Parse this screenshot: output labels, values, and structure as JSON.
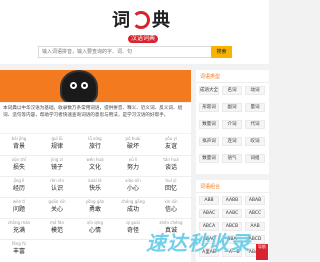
{
  "logo": {
    "left_char": "词",
    "right_char": "典",
    "badge": "汉语词典"
  },
  "search": {
    "placeholder": "输入词语拼音，输入要查询的字、词、句",
    "button_label": "搜索"
  },
  "intro": {
    "text": "本词典以中华汉语为基础，收录数万条常用词语，提供拼音、释义、近义词、反义词、组词、造句等内容，帮助学习者快速查询词语的意思与用法，是学习汉语的好帮手。"
  },
  "words": [
    {
      "py": "bèi jǐng",
      "hz": "背景"
    },
    {
      "py": "guī lǜ",
      "hz": "规律"
    },
    {
      "py": "lǚ xíng",
      "hz": "旅行"
    },
    {
      "py": "pò huài",
      "hz": "破坏"
    },
    {
      "py": "yǒu yì",
      "hz": "友谊"
    },
    {
      "py": "sǔn shī",
      "hz": "损失"
    },
    {
      "py": "jìng zi",
      "hz": "镜子"
    },
    {
      "py": "wén huà",
      "hz": "文化"
    },
    {
      "py": "nǔ lì",
      "hz": "努力"
    },
    {
      "py": "tán huà",
      "hz": "谈话"
    },
    {
      "py": "jīng lì",
      "hz": "经历"
    },
    {
      "py": "rèn shi",
      "hz": "认识"
    },
    {
      "py": "kuài lè",
      "hz": "快乐"
    },
    {
      "py": "xiǎo xīn",
      "hz": "小心"
    },
    {
      "py": "huí yì",
      "hz": "回忆"
    },
    {
      "py": "wèn tí",
      "hz": "问题"
    },
    {
      "py": "guān xīn",
      "hz": "关心"
    },
    {
      "py": "yǒng gǎn",
      "hz": "勇敢"
    },
    {
      "py": "chéng gōng",
      "hz": "成功"
    },
    {
      "py": "xìn xīn",
      "hz": "信心"
    },
    {
      "py": "chōng mǎn",
      "hz": "充满"
    },
    {
      "py": "mó fàn",
      "hz": "模范"
    },
    {
      "py": "xīn qíng",
      "hz": "心情"
    },
    {
      "py": "qí guài",
      "hz": "奇怪"
    },
    {
      "py": "zhēn chéng",
      "hz": "真诚"
    },
    {
      "py": "fēng fù",
      "hz": "丰富"
    }
  ],
  "side1": {
    "title": "词语类型",
    "tags": [
      "成语大全",
      "名词",
      "动词",
      "形容词",
      "副词",
      "量词",
      "数量词",
      "介词",
      "代词",
      "拟声词",
      "连词",
      "叹词",
      "数量词",
      "语气",
      "词组"
    ]
  },
  "side2": {
    "title": "词语组合",
    "tags": [
      "ABB",
      "AABB",
      "ABAB",
      "ABAC",
      "AABC",
      "ABCC",
      "ABCA",
      "ABCB",
      "AAB",
      "ABAC",
      "BBA",
      "ABCD",
      "A里AB",
      "一A一B",
      "ABAB"
    ]
  },
  "watermark": {
    "text": "速达秒收录",
    "tag": "导航"
  },
  "colors": {
    "accent": "#f47a20",
    "brand_red": "#d9232e",
    "button": "#f7b500"
  }
}
